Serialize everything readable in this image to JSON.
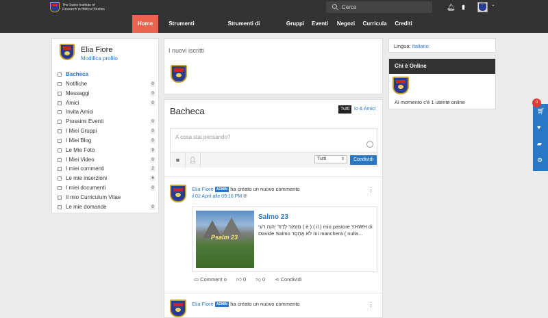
{
  "header": {
    "logo_text": "The Swiss Institute of Research in Biblical Studies",
    "search_placeholder": "Cerca"
  },
  "nav": {
    "items": [
      "Home",
      "Strumenti Social",
      "Strumenti di approfondimento",
      "Gruppi",
      "Eventi",
      "Negozi",
      "Curricula",
      "Crediti"
    ],
    "active": "Home"
  },
  "profile": {
    "name": "Elia Fiore",
    "edit_label": "Modifica profilo"
  },
  "menu": [
    {
      "label": "Bacheca",
      "count": ""
    },
    {
      "label": "Notifiche",
      "count": "0"
    },
    {
      "label": "Messaggi",
      "count": "0"
    },
    {
      "label": "Amici",
      "count": "0"
    },
    {
      "label": "Invita Amici",
      "count": ""
    },
    {
      "label": "Prossimi Eventi",
      "count": "0"
    },
    {
      "label": "I Miei Gruppi",
      "count": "0"
    },
    {
      "label": "I Miei Blog",
      "count": "0"
    },
    {
      "label": "Le Mie Foto",
      "count": "9"
    },
    {
      "label": "I Miei Video",
      "count": "0"
    },
    {
      "label": "I miei commenti",
      "count": "2"
    },
    {
      "label": "Le mie inserzioni",
      "count": "8"
    },
    {
      "label": "I miei documenti",
      "count": "0"
    },
    {
      "label": "Il mio Curriculum Vitae",
      "count": ""
    },
    {
      "label": "Le mie domande",
      "count": "0"
    }
  ],
  "new_members": {
    "title": "I nuovi iscritti"
  },
  "wall": {
    "title": "Bacheca",
    "filter_all": "Tutti",
    "filter_friends": "Io & Amici",
    "placeholder": "A cosa stai pensando?",
    "audience": "Tutti",
    "share_label": "Condividi"
  },
  "feed": [
    {
      "author": "Elia Fiore",
      "badge": "ADMIN",
      "action": "ha creato un nuovo commento",
      "date": "il 02 April alle 09:16 PM",
      "card_title": "Salmo 23",
      "card_image_text": "Psalm 23",
      "card_body": "מִזְמוֹר לְדָוִד יְהוָה רֹעִי ( è ) ( il ) mio pastore YHWH di Davide Salmo לֹא אֶחְסָר mi mancherà ( nulla...",
      "comment_label": "Comment o",
      "likes": "0",
      "dislikes": "0",
      "share_label": "Condividi"
    },
    {
      "author": "Elia Fiore",
      "badge": "ADMIN",
      "action": "ha creato un nuovo commento"
    }
  ],
  "right": {
    "language_label": "Lingua:",
    "language_value": "Italiano",
    "online_title": "Chi è Online",
    "online_text": "Al momento c'è 1 utente online"
  },
  "side_tabs": {
    "cart_count": "0"
  }
}
